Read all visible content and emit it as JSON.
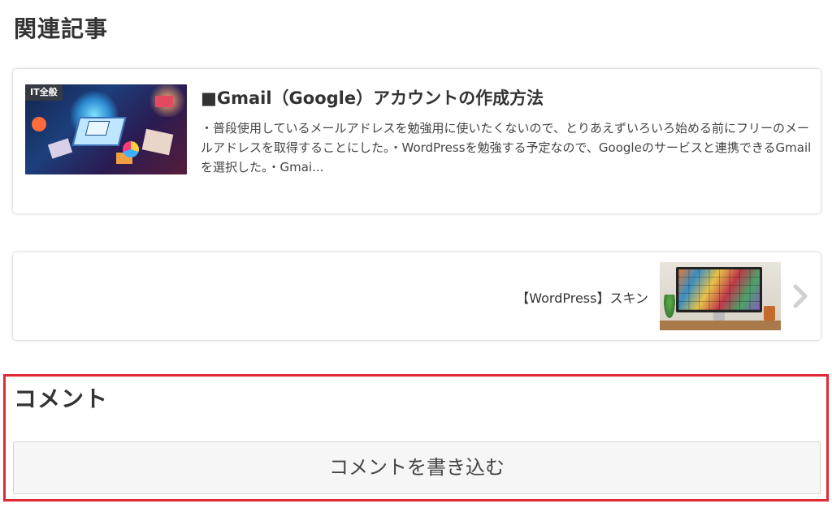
{
  "related": {
    "heading": "関連記事",
    "article": {
      "category_tag": "IT全般",
      "title": "■Gmail（Google）アカウントの作成方法",
      "excerpt": "・普段使用しているメールアドレスを勉強用に使いたくないので、とりあえずいろいろ始める前にフリーのメールアドレスを取得することにした。・WordPressを勉強する予定なので、Googleのサービスと連携できるGmailを選択した。・Gmai..."
    }
  },
  "post_navigation": {
    "label": "【WordPress】スキン",
    "arrow_icon": "chevron-right-icon"
  },
  "comments": {
    "heading": "コメント",
    "write_button_label": "コメントを書き込む",
    "highlight_color": "#e02a36"
  }
}
